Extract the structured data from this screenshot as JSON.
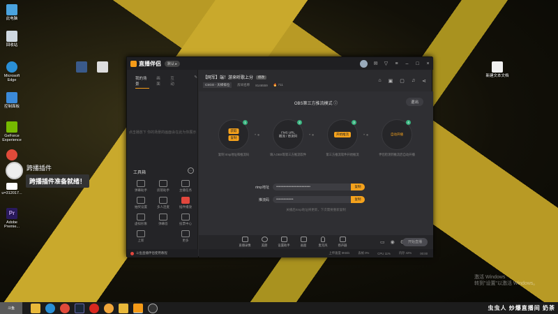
{
  "desktop": {
    "icons": [
      {
        "label": "此电脑",
        "icon": "computer-icon",
        "color": "#4aa3df"
      },
      {
        "label": "回收站",
        "icon": "recycle-bin-icon",
        "color": "#cfd8e0"
      },
      {
        "label": "Microsoft Edge",
        "icon": "edge-icon",
        "color": "#2a8fd6"
      },
      {
        "label": "控制面板",
        "icon": "control-panel-icon",
        "color": "#3b8ad9"
      },
      {
        "label": "GeForce Experience",
        "icon": "geforce-icon",
        "color": "#76b900"
      },
      {
        "label": "",
        "icon": "chrome-icon",
        "color": "#e04a3a"
      },
      {
        "label": "u=312017...",
        "icon": "image-file-icon",
        "color": "#ffffff"
      },
      {
        "label": "Adobe Premie...",
        "icon": "premiere-icon",
        "color": "#2a1a5e"
      },
      {
        "label": "新建文本文档",
        "icon": "text-file-icon",
        "color": "#f0f0f0"
      }
    ]
  },
  "window": {
    "app_name": "直播伴侣",
    "version_badge": "默认 ▸",
    "left_tabs": [
      "我的场景",
      "画面",
      "互动"
    ],
    "left_empty_text": "点击播放下 你的场景的画面会在此为你展示",
    "toolbox_title": "工具箱",
    "tools": [
      {
        "label": "弹幕助手"
      },
      {
        "label": "房管助手"
      },
      {
        "label": "主播任务"
      },
      {
        "label": "抽奖设置"
      },
      {
        "label": "多人连麦"
      },
      {
        "label": "插件播放"
      },
      {
        "label": "虚拟形象"
      },
      {
        "label": "弹幕答"
      },
      {
        "label": "投票中心"
      },
      {
        "label": "上新"
      },
      {
        "label": ""
      },
      {
        "label": "更多"
      }
    ],
    "left_footer": "斗鱼直播伴侣使用教程",
    "room": {
      "title": "【网军】端！游来听歌上分",
      "edit": "修改",
      "game": "CSGO - 天梯排位",
      "room_label": "房间名称",
      "room_id": "8146559",
      "hot": "711"
    },
    "stage": {
      "mode_title": "OBS第三方推流模式 ⓘ",
      "exit": "退出",
      "steps": [
        {
          "num": "1",
          "lines": [
            "获取",
            "复制"
          ],
          "caption": "复制 rtmp地址和推流码"
        },
        {
          "num": "2",
          "lines": [
            "FMS URL",
            "推流 / 串流码"
          ],
          "caption": "填入OBS等第三方推流软件"
        },
        {
          "num": "3",
          "lines": [
            "开始推流"
          ],
          "caption": "第三方推流软件开始推流"
        },
        {
          "num": "4",
          "lines": [
            "自动开播"
          ],
          "caption": "伴侣检测到推流后自动开播"
        }
      ],
      "rtmp_label": "rtmp地址",
      "rtmp_value": "••••••••••••••••••••••••••••",
      "key_label": "推流码",
      "key_value": "••••••••••••••",
      "copy_label": "复制",
      "hint": "关播后rtmp地址将更新，下次需要重新复制"
    },
    "bottom_tools": [
      "直播录像",
      "美颜",
      "设置助手",
      "画面",
      "麦克风",
      "扬声器"
    ],
    "start_button": "开始直播",
    "status": [
      "上传速度 0KB/s",
      "丢帧 0%",
      "CPU 11%",
      "内存 42%",
      "00:00"
    ]
  },
  "toast": {
    "name": "跨播插件",
    "message": "跨播插件准备就绪！"
  },
  "watermark": [
    "激活 Windows",
    "转到\"设置\"以激活 Windows。"
  ],
  "taskbar": {
    "start_label": "斗鱼",
    "apps": [
      "file-explorer-icon",
      "edge-icon",
      "chrome-icon",
      "steam-icon",
      "netease-music-icon",
      "qq-icon",
      "folder-icon",
      "douyu-companion-icon",
      "obs-icon"
    ],
    "tray_text": "虫虫人 炒爆直播间 奶茶"
  },
  "colors": {
    "accent": "#f5a21c",
    "step_badge": "#37b37e",
    "window_bg": "#2b2b2e"
  }
}
